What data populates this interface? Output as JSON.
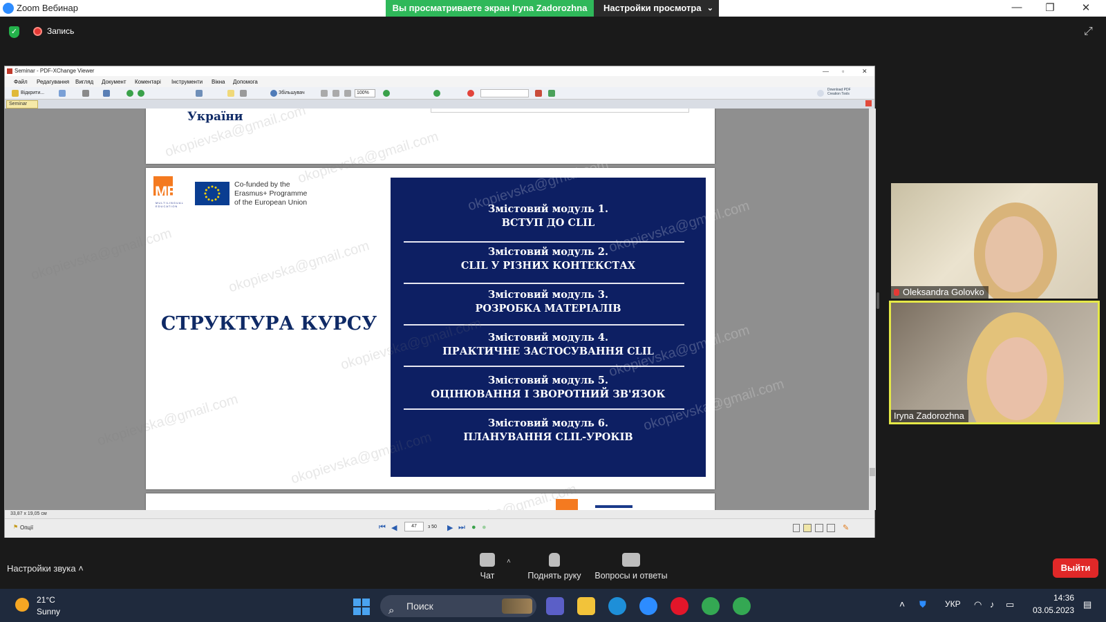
{
  "zoom": {
    "window_title": "Zoom Вебинар",
    "share_banner": "Вы просматриваете экран Iryna Zadorozhna",
    "view_options": "Настройки просмотра",
    "record_label": "Запись",
    "audio_settings": "Настройки звука",
    "controls": [
      {
        "label": "Чат",
        "icon": "chat-icon"
      },
      {
        "label": "Поднять руку",
        "icon": "raise-hand-icon"
      },
      {
        "label": "Вопросы и ответы",
        "icon": "qa-icon"
      }
    ],
    "exit_label": "Выйти"
  },
  "pdf_viewer": {
    "title": "Seminar - PDF-XChange Viewer",
    "menu": [
      "Файл",
      "Редагування",
      "Вигляд",
      "Документ",
      "Коментарі",
      "Інструменти",
      "Вікна",
      "Допомога"
    ],
    "toolbar": {
      "open_label": "Відкрити...",
      "zoom_tool_label": "Збільшувач",
      "zoom_level": "100%",
      "download_label": "Download PDF Creation Tools"
    },
    "tab_label": "Seminar",
    "page_size": "33,87 x 19,05 см",
    "options_label": "Опції",
    "current_page": "47",
    "page_total": "з 50"
  },
  "slide": {
    "prev_page_text": "України",
    "logo_text": "ME",
    "logo_subtext": "MULTILINGUAL EDUCATION",
    "eu_text": [
      "Co-funded by the",
      "Erasmus+ Programme",
      "of the European Union"
    ],
    "course_title": "СТРУКТУРА КУРСУ",
    "modules": [
      {
        "line1": "Змістовий модуль 1.",
        "line2": "ВСТУП ДО CLIL"
      },
      {
        "line1": "Змістовий модуль 2.",
        "line2": "CLIL У РІЗНИХ КОНТЕКСТАХ"
      },
      {
        "line1": "Змістовий модуль 3.",
        "line2": "РОЗРОБКА МАТЕРІАЛІВ"
      },
      {
        "line1": "Змістовий модуль 4.",
        "line2": "ПРАКТИЧНЕ ЗАСТОСУВАННЯ CLIL"
      },
      {
        "line1": "Змістовий модуль 5.",
        "line2": "ОЦІНЮВАННЯ І ЗВОРОТНИЙ ЗВ'ЯЗОК"
      },
      {
        "line1": "Змістовий модуль 6.",
        "line2": "ПЛАНУВАННЯ CLIL-УРОКІВ"
      }
    ],
    "watermark": "okopievska@gmail.com"
  },
  "participants": [
    {
      "name": "Oleksandra Golovko",
      "muted": true
    },
    {
      "name": "Iryna Zadorozhna",
      "muted": false,
      "active_speaker": true
    }
  ],
  "taskbar": {
    "weather_temp": "21°C",
    "weather_desc": "Sunny",
    "search_label": "Поиск",
    "language": "УКР",
    "time": "14:36",
    "date": "03.05.2023"
  },
  "colors": {
    "share_banner": "#2fb85a",
    "active_speaker_border": "#e5e847",
    "exit_button": "#e02828",
    "module_panel": "#0d1f63",
    "slide_title": "#0f2a66",
    "logo_orange": "#f47a20"
  }
}
